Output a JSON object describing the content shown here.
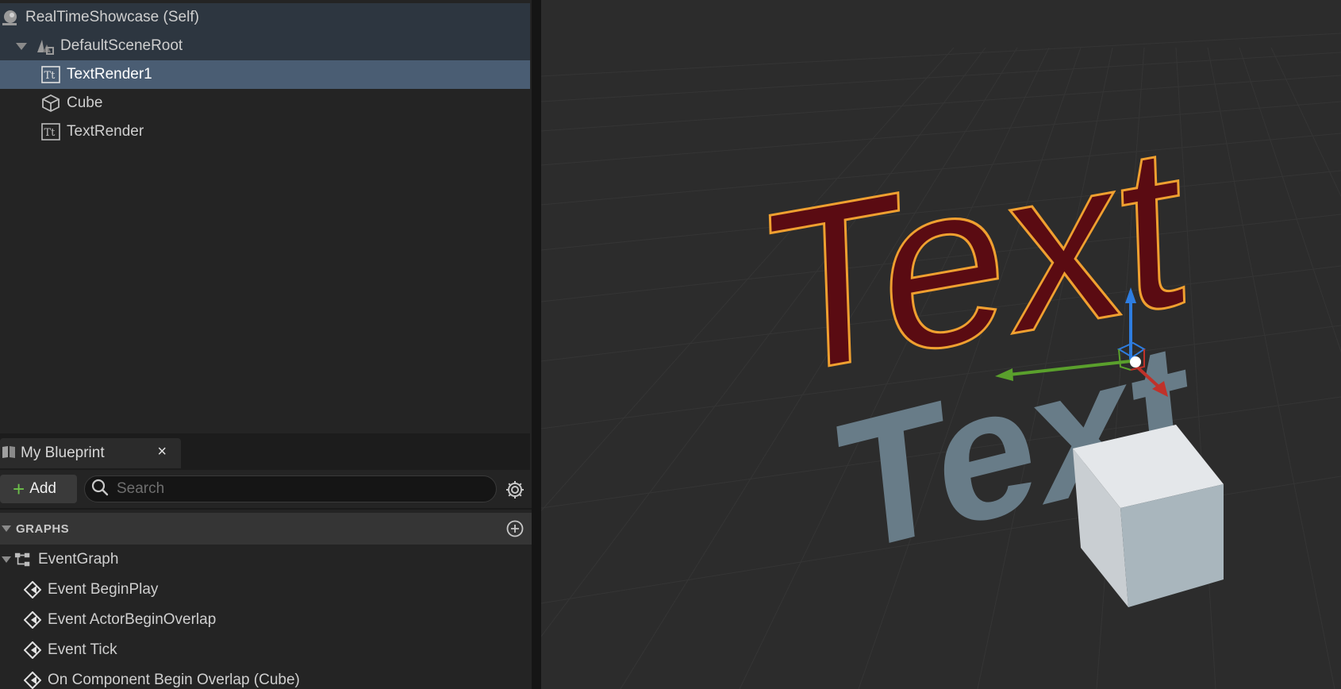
{
  "components": {
    "root": {
      "label": "RealTimeShowcase (Self)",
      "icon": "actor-sphere-icon"
    },
    "scene_root": {
      "label": "DefaultSceneRoot",
      "icon": "scene-root-icon"
    },
    "items": [
      {
        "label": "TextRender1",
        "icon": "text-render-icon",
        "selected": true
      },
      {
        "label": "Cube",
        "icon": "cube-icon",
        "selected": false
      },
      {
        "label": "TextRender",
        "icon": "text-render-icon",
        "selected": false
      }
    ]
  },
  "my_blueprint": {
    "tab_title": "My Blueprint",
    "close_label": "×",
    "add_label": "Add",
    "search_placeholder": "Search",
    "graphs_header": "GRAPHS",
    "event_graph": "EventGraph",
    "events": [
      "Event BeginPlay",
      "Event ActorBeginOverlap",
      "Event Tick",
      "On Component Begin Overlap (Cube)"
    ]
  },
  "viewport": {
    "selected_text": "Text",
    "other_text": "Text",
    "colors": {
      "selected_text_fill": "#5a0b12",
      "selection_outline": "#f0a030",
      "unselected_text": "#687c88",
      "cube": "#dfe3e6",
      "gizmo_z": "#2e7de0",
      "gizmo_y": "#5aa02c",
      "gizmo_x": "#c0322a"
    }
  },
  "colors": {
    "selected_row": "#4a5d73",
    "header_row": "#2d3640",
    "accent_add": "#6cc04a"
  }
}
